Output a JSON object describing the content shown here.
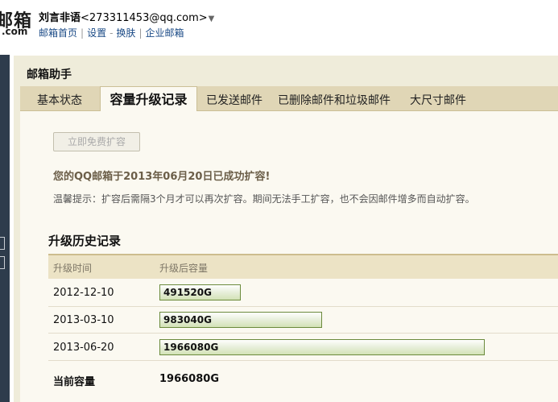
{
  "header": {
    "logo_main": "邮箱",
    "logo_com": ".com",
    "user_name": "刘言非语",
    "user_email": "<273311453@qq.com>",
    "caret": "▼",
    "links": [
      "邮箱首页",
      "设置",
      "换肤",
      "企业邮箱"
    ]
  },
  "panel": {
    "title": "邮箱助手",
    "tabs": [
      {
        "label": "基本状态",
        "active": false
      },
      {
        "label": "容量升级记录",
        "active": true
      },
      {
        "label": "已发送邮件",
        "active": false
      },
      {
        "label": "已删除邮件和垃圾邮件",
        "active": false
      },
      {
        "label": "大尺寸邮件",
        "active": false
      }
    ]
  },
  "content": {
    "expand_button": "立即免费扩容",
    "success_message": "您的QQ邮箱于2013年06月20日已成功扩容!",
    "tip": "温馨提示：扩容后需隔3个月才可以再次扩容。期间无法手工扩容，也不会因邮件增多而自动扩容。",
    "history_title": "升级历史记录",
    "table": {
      "headers": [
        "升级时间",
        "升级后容量"
      ],
      "rows": [
        {
          "date": "2012-12-10",
          "capacity": "491520G",
          "capacity_value": 491520
        },
        {
          "date": "2013-03-10",
          "capacity": "983040G",
          "capacity_value": 983040
        },
        {
          "date": "2013-06-20",
          "capacity": "1966080G",
          "capacity_value": 1966080
        }
      ],
      "max_capacity_value": 1966080
    },
    "current_label": "当前容量",
    "current_value": "1966080G"
  },
  "colors": {
    "panel_bg": "#efecda",
    "tab_strip": "#e0d6b6",
    "link": "#1a4a86",
    "bar_border": "#6b8a3c"
  }
}
